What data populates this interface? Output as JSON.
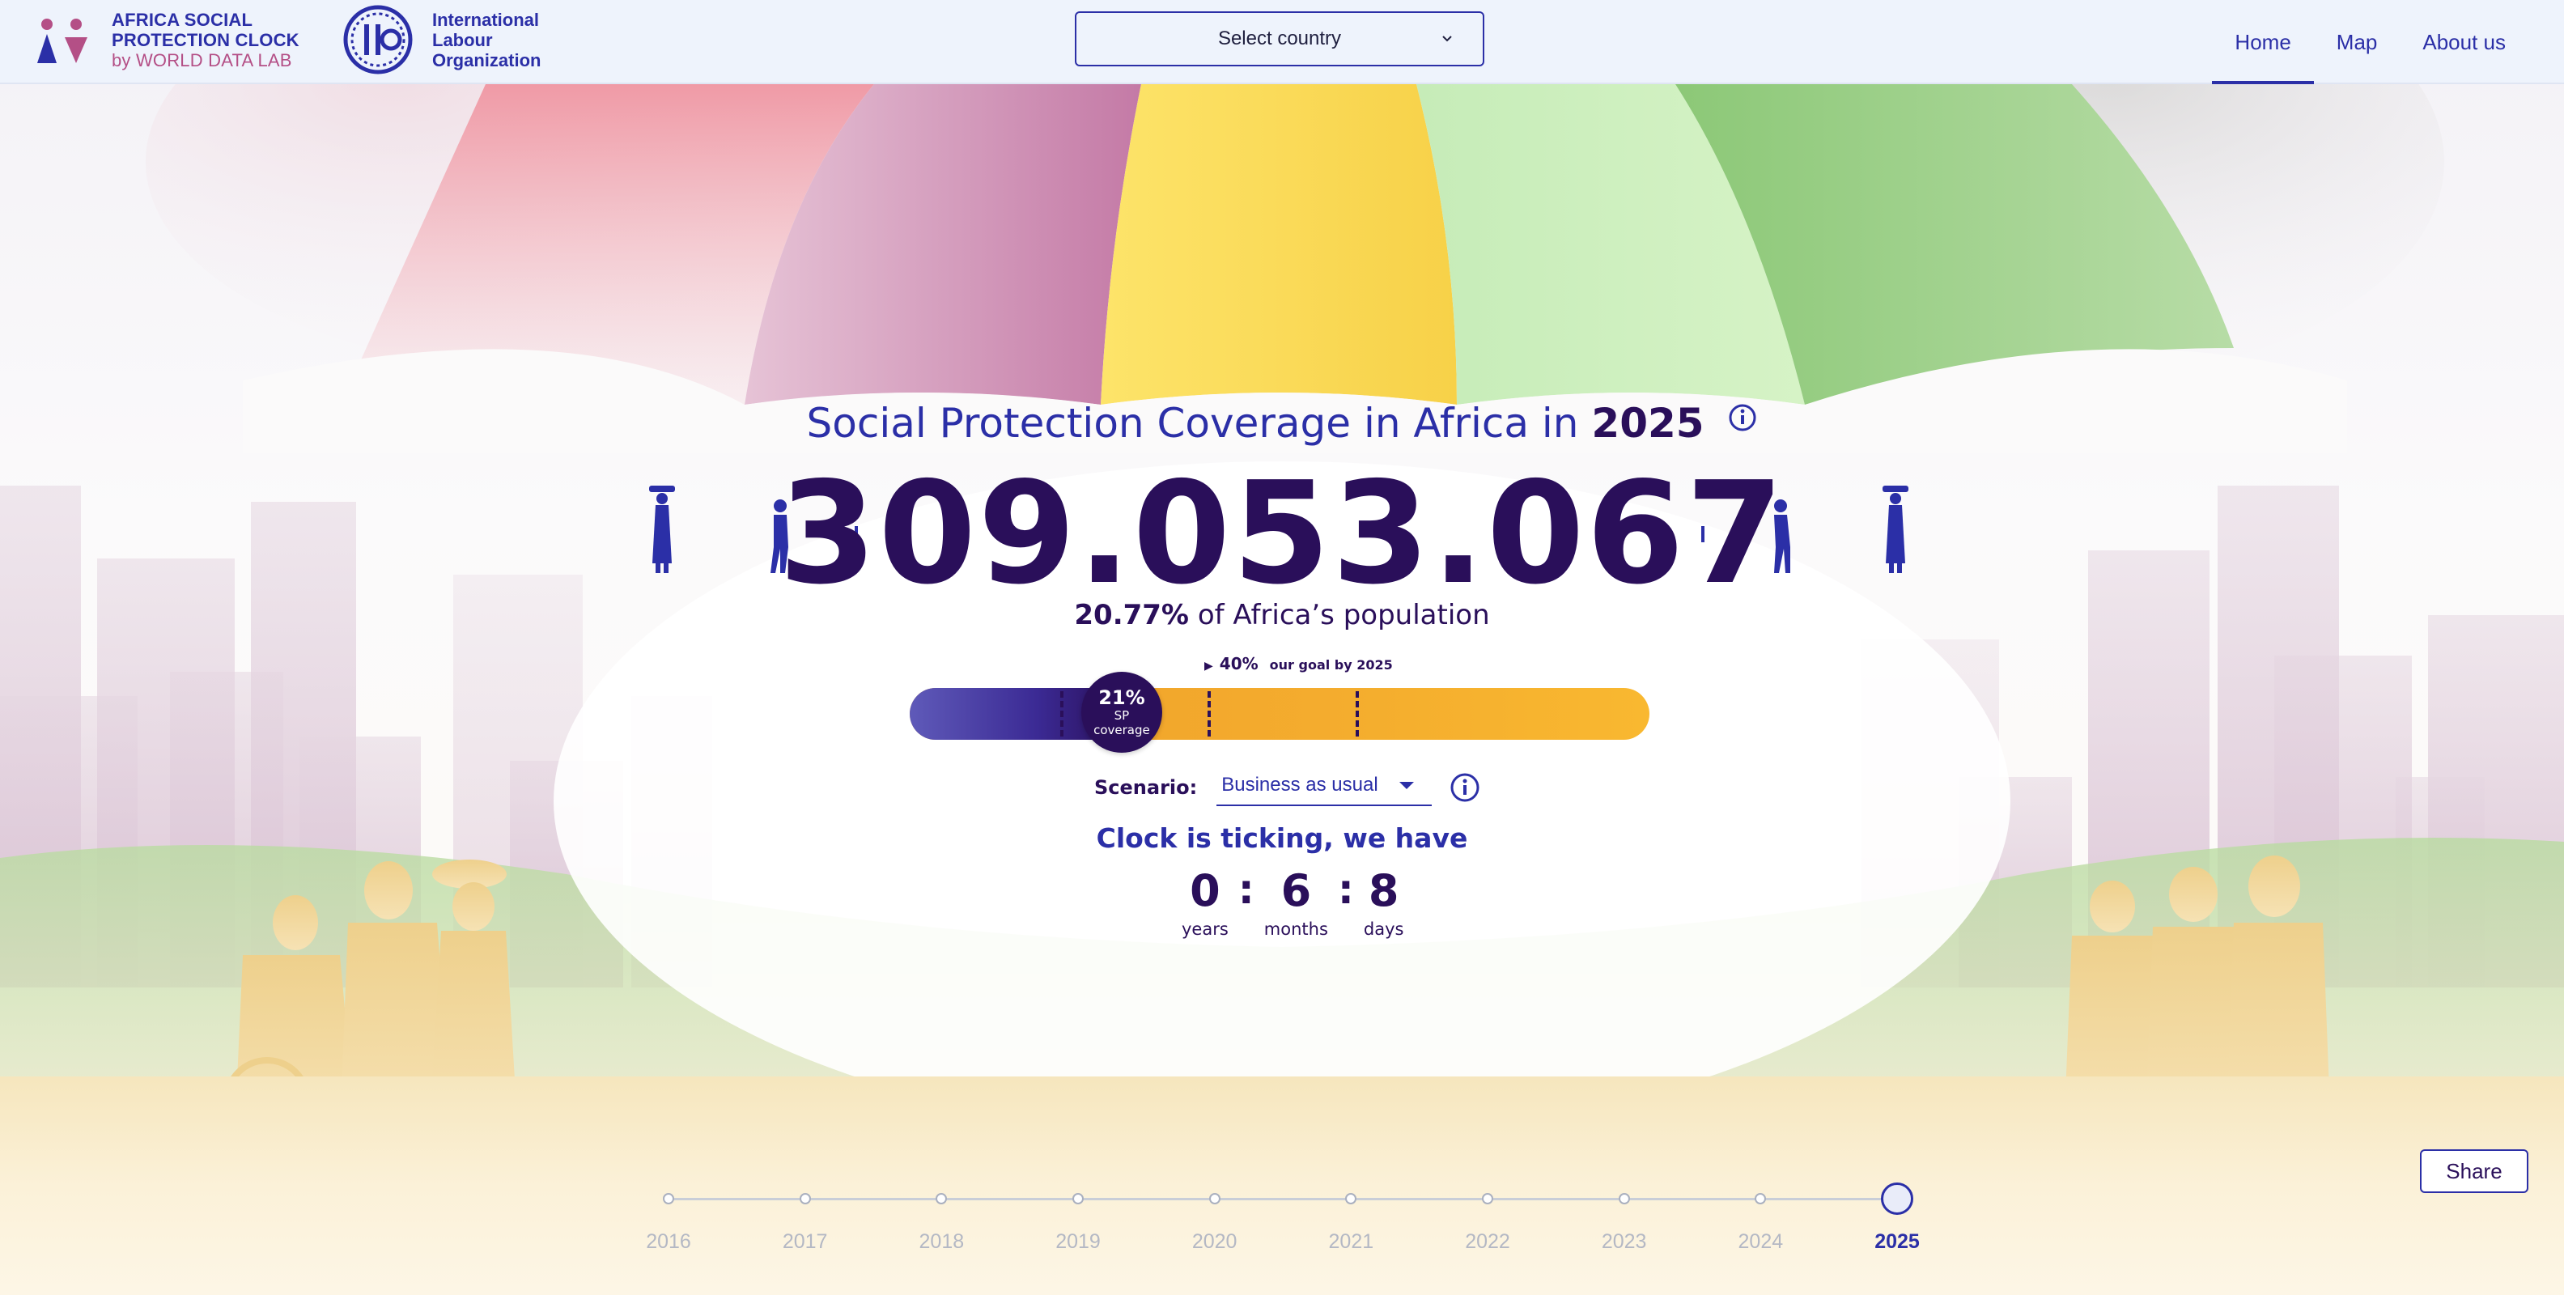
{
  "colors": {
    "brand_blue": "#2b2fa7",
    "deep_purple": "#2a0f5a",
    "orange": "#f4ad2e",
    "nav_bg": "#eef3fc"
  },
  "header": {
    "brand": {
      "line1": "AFRICA SOCIAL",
      "line2": "PROTECTION CLOCK",
      "line3": "by WORLD DATA LAB"
    },
    "ilo": {
      "line1": "International",
      "line2": "Labour",
      "line3": "Organization"
    },
    "country_select": {
      "value": "Select country",
      "icon": "chevron-down-icon"
    },
    "nav": [
      {
        "label": "Home",
        "active": true
      },
      {
        "label": "Map",
        "active": false
      },
      {
        "label": "About us",
        "active": false
      }
    ]
  },
  "main": {
    "headline_prefix": "Social Protection Coverage in Africa in",
    "headline_year": "2025",
    "headline_icon": "info-icon",
    "big_number": "309.053.067",
    "percent_value": "20.77%",
    "percent_suffix": "of Africa’s population",
    "goal": {
      "marker": "▶",
      "percent": "40%",
      "label": "our goal by 2025"
    },
    "progress": {
      "current_fraction": 0.21,
      "knob_percent": "21%",
      "knob_label_1": "SP",
      "knob_label_2": "coverage",
      "dash_fractions": [
        0.4,
        0.6,
        0.8
      ]
    },
    "scenario": {
      "label": "Scenario:",
      "value": "Business as usual",
      "icon": "info-icon"
    },
    "ticking_text": "Clock is ticking, we have",
    "countdown": {
      "years": "0",
      "months": "6",
      "days": "8",
      "separator": ":",
      "years_label": "years",
      "months_label": "months",
      "days_label": "days"
    }
  },
  "timeline": {
    "years": [
      "2016",
      "2017",
      "2018",
      "2019",
      "2020",
      "2021",
      "2022",
      "2023",
      "2024",
      "2025"
    ],
    "active_index": 9
  },
  "share_label": "Share"
}
